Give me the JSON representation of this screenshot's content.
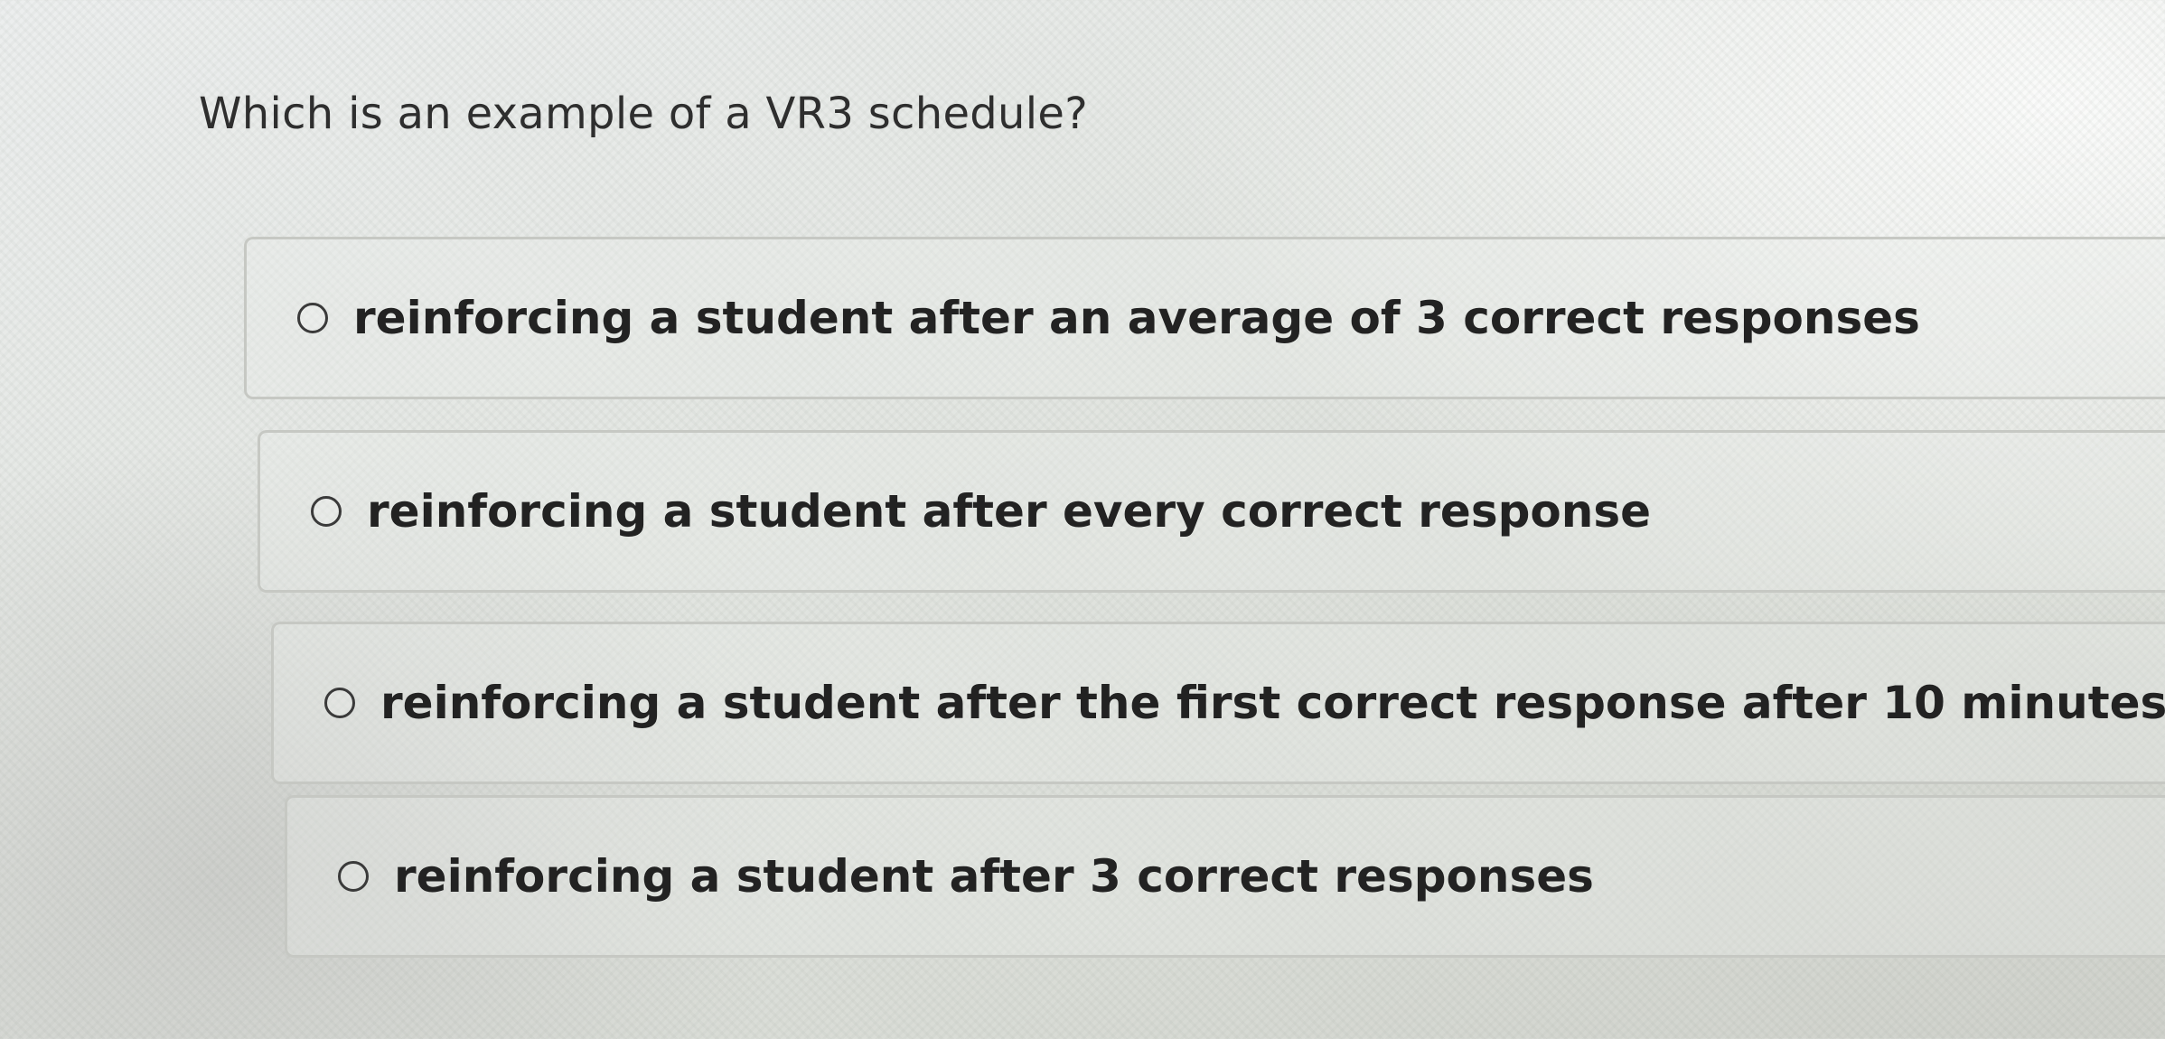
{
  "question": {
    "text": "Which is an example of a VR3 schedule?"
  },
  "options": [
    {
      "label": "reinforcing a student after an average of 3 correct responses",
      "selected": false
    },
    {
      "label": "reinforcing a student after every correct response",
      "selected": false
    },
    {
      "label": "reinforcing a student after the first correct response after 10 minutes.",
      "selected": false
    },
    {
      "label": "reinforcing a student after 3 correct responses",
      "selected": false
    }
  ],
  "colors": {
    "text": "#222222",
    "border": "#c6c8c3",
    "background": "#e3e6e2"
  }
}
